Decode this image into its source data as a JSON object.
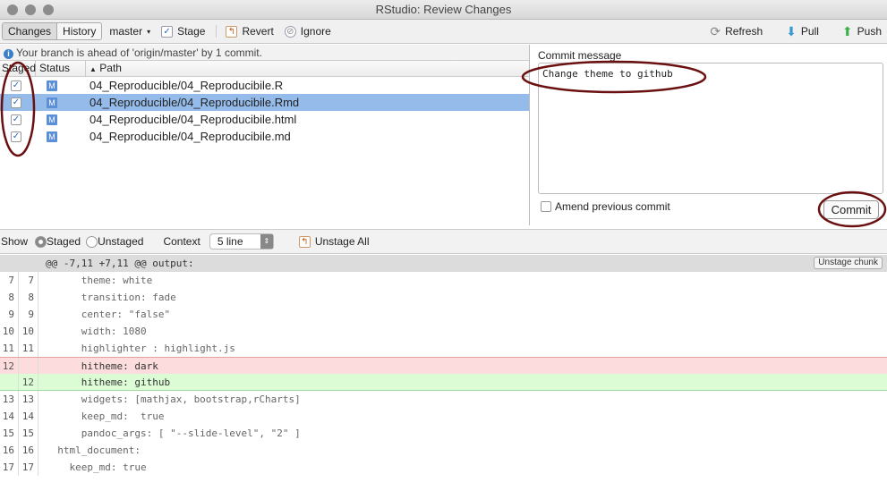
{
  "window": {
    "title": "RStudio: Review Changes"
  },
  "toolbar": {
    "changes": "Changes",
    "history": "History",
    "branch": "master",
    "stage": "Stage",
    "revert": "Revert",
    "ignore": "Ignore",
    "refresh": "Refresh",
    "pull": "Pull",
    "push": "Push"
  },
  "info": "Your branch is ahead of 'origin/master' by 1 commit.",
  "columns": {
    "staged": "Staged",
    "status": "Status",
    "path": "Path"
  },
  "files": [
    {
      "status": "M",
      "path": "04_Reproducible/04_Reproducibile.R",
      "staged": true
    },
    {
      "status": "M",
      "path": "04_Reproducible/04_Reproducibile.Rmd",
      "staged": true,
      "selected": true
    },
    {
      "status": "M",
      "path": "04_Reproducible/04_Reproducibile.html",
      "staged": true
    },
    {
      "status": "M",
      "path": "04_Reproducible/04_Reproducibile.md",
      "staged": true
    }
  ],
  "commit": {
    "label": "Commit message",
    "message": "Change theme to github",
    "amend": "Amend previous commit",
    "button": "Commit"
  },
  "diffbar": {
    "show": "Show",
    "staged": "Staged",
    "unstaged": "Unstaged",
    "context": "Context",
    "context_value": "5 line",
    "unstage_all": "Unstage All"
  },
  "diff": {
    "hunk": "@@ -7,11 +7,11 @@ output:",
    "unstage_chunk": "Unstage chunk",
    "lines": [
      {
        "o": "7",
        "n": "7",
        "t": "      theme: white",
        "k": ""
      },
      {
        "o": "8",
        "n": "8",
        "t": "      transition: fade",
        "k": ""
      },
      {
        "o": "9",
        "n": "9",
        "t": "      center: \"false\"",
        "k": ""
      },
      {
        "o": "10",
        "n": "10",
        "t": "      width: 1080",
        "k": ""
      },
      {
        "o": "11",
        "n": "11",
        "t": "      highlighter : highlight.js",
        "k": ""
      },
      {
        "o": "12",
        "n": "",
        "t": "      hitheme: dark",
        "k": "del"
      },
      {
        "o": "",
        "n": "12",
        "t": "      hitheme: github",
        "k": "add"
      },
      {
        "o": "13",
        "n": "13",
        "t": "      widgets: [mathjax, bootstrap,rCharts]",
        "k": ""
      },
      {
        "o": "14",
        "n": "14",
        "t": "      keep_md:  true",
        "k": ""
      },
      {
        "o": "15",
        "n": "15",
        "t": "      pandoc_args: [ \"--slide-level\", \"2\" ]",
        "k": ""
      },
      {
        "o": "16",
        "n": "16",
        "t": "  html_document:",
        "k": ""
      },
      {
        "o": "17",
        "n": "17",
        "t": "    keep_md: true",
        "k": ""
      }
    ]
  }
}
